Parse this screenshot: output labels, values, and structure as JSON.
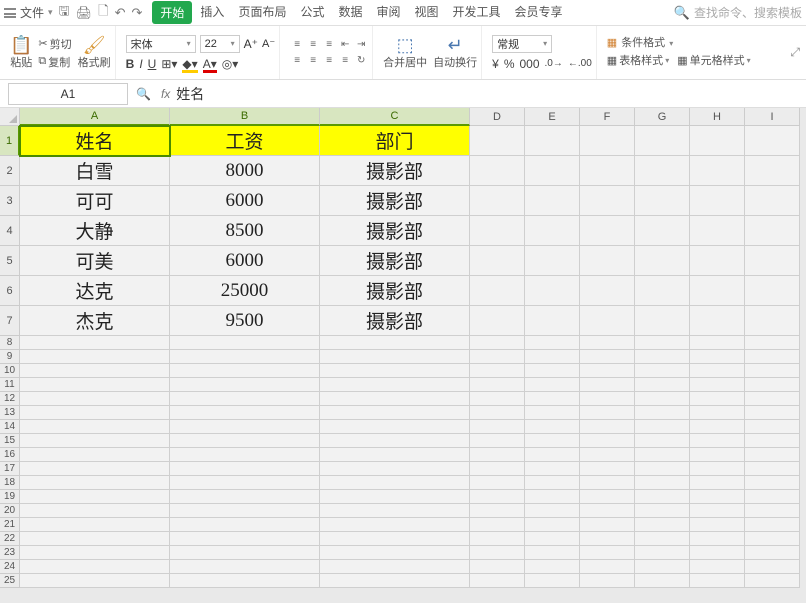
{
  "menu": {
    "file": "文件",
    "tabs": [
      "开始",
      "插入",
      "页面布局",
      "公式",
      "数据",
      "审阅",
      "视图",
      "开发工具",
      "会员专享"
    ],
    "active": 0,
    "search_placeholder": "查找命令、搜索模板"
  },
  "ribbon": {
    "paste": "粘贴",
    "cut": "剪切",
    "copy": "复制",
    "format_painter": "格式刷",
    "font_name": "宋体",
    "font_size": "22",
    "merge": "合并居中",
    "wrap": "自动换行",
    "number_format": "常规",
    "cond_format": "条件格式",
    "table_style": "表格样式",
    "cell_style": "单元格样式"
  },
  "formula_bar": {
    "name_box": "A1",
    "value": "姓名"
  },
  "columns": [
    "A",
    "B",
    "C",
    "D",
    "E",
    "F",
    "G",
    "H",
    "I"
  ],
  "selected_cols": [
    "A",
    "B",
    "C"
  ],
  "data_rows": [
    {
      "r": "1",
      "a": "姓名",
      "b": "工资",
      "c": "部门",
      "hdr": true
    },
    {
      "r": "2",
      "a": "白雪",
      "b": "8000",
      "c": "摄影部"
    },
    {
      "r": "3",
      "a": "可可",
      "b": "6000",
      "c": "摄影部"
    },
    {
      "r": "4",
      "a": "大静",
      "b": "8500",
      "c": "摄影部"
    },
    {
      "r": "5",
      "a": "可美",
      "b": "6000",
      "c": "摄影部"
    },
    {
      "r": "6",
      "a": "达克",
      "b": "25000",
      "c": "摄影部"
    },
    {
      "r": "7",
      "a": "杰克",
      "b": "9500",
      "c": "摄影部"
    }
  ],
  "empty_rows": [
    "8",
    "9",
    "10",
    "11",
    "12",
    "13",
    "14",
    "15",
    "16",
    "17",
    "18",
    "19",
    "20",
    "21",
    "22",
    "23",
    "24",
    "25"
  ]
}
